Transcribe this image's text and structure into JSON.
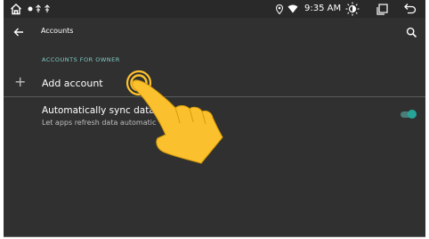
{
  "status_bar": {
    "home_icon": "home-icon",
    "notification_icons": [
      "record-icon",
      "usb-icon",
      "usb-icon"
    ],
    "location_icon": "location-icon",
    "wifi_icon": "wifi-icon",
    "time": "9:35 AM",
    "brightness_icon": "brightness-icon",
    "windows_icon": "recent-windows-icon",
    "back_icon": "back-icon"
  },
  "toolbar": {
    "back_icon": "arrow-back-icon",
    "title": "Accounts",
    "search_icon": "search-icon"
  },
  "section": {
    "header": "ACCOUNTS FOR OWNER"
  },
  "add_account": {
    "icon": "plus-icon",
    "label": "Add account"
  },
  "sync": {
    "title": "Automatically sync data",
    "subtitle": "Let apps refresh data automatic",
    "enabled": true
  },
  "overlay": {
    "icon": "pointing-hand-icon"
  },
  "colors": {
    "background": "#303030",
    "accent": "#26a69a",
    "section_header": "#80cbc4",
    "hand": "#fbc02d"
  }
}
